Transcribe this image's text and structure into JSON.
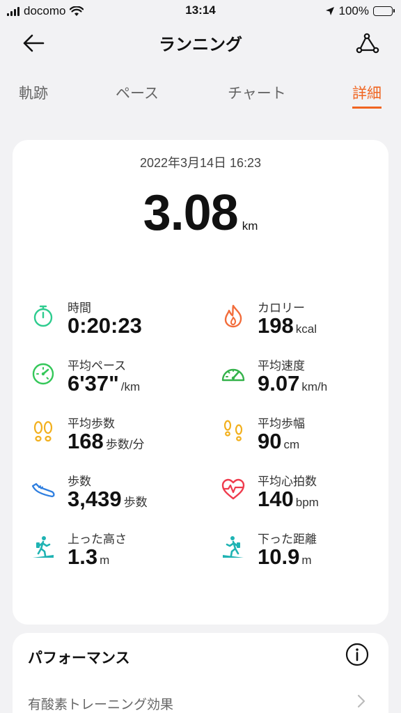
{
  "status": {
    "carrier": "docomo",
    "time": "13:14",
    "battery": "100%"
  },
  "nav": {
    "title": "ランニング"
  },
  "tabs": [
    {
      "label": "軌跡"
    },
    {
      "label": "ペース"
    },
    {
      "label": "チャート"
    },
    {
      "label": "詳細"
    }
  ],
  "summary": {
    "datetime": "2022年3月14日 16:23",
    "distance": "3.08",
    "distance_unit": "km"
  },
  "metrics": [
    {
      "label": "時間",
      "value": "0:20:23",
      "unit": "",
      "icon": "stopwatch-icon",
      "color": "#2ecc8f"
    },
    {
      "label": "カロリー",
      "value": "198",
      "unit": "kcal",
      "icon": "flame-icon",
      "color": "#f26c3a"
    },
    {
      "label": "平均ペース",
      "value": "6'37\"",
      "unit": "/km",
      "icon": "pace-gauge-icon",
      "color": "#34c759"
    },
    {
      "label": "平均速度",
      "value": "9.07",
      "unit": "km/h",
      "icon": "speedometer-icon",
      "color": "#34b24a"
    },
    {
      "label": "平均歩数",
      "value": "168",
      "unit": "歩数/分",
      "icon": "footprints-icon",
      "color": "#f2b01e"
    },
    {
      "label": "平均歩幅",
      "value": "90",
      "unit": "cm",
      "icon": "stride-footprints-icon",
      "color": "#f2b01e"
    },
    {
      "label": "歩数",
      "value": "3,439",
      "unit": "歩数",
      "icon": "shoe-icon",
      "color": "#2f7fe0"
    },
    {
      "label": "平均心拍数",
      "value": "140",
      "unit": "bpm",
      "icon": "heart-rate-icon",
      "color": "#ef3b4d"
    },
    {
      "label": "上った高さ",
      "value": "1.3",
      "unit": "m",
      "icon": "hiker-up-icon",
      "color": "#1fb3b3"
    },
    {
      "label": "下った距離",
      "value": "10.9",
      "unit": "m",
      "icon": "hiker-down-icon",
      "color": "#1fb3b3"
    }
  ],
  "performance": {
    "title": "パフォーマンス",
    "row_label": "有酸素トレーニング効果"
  }
}
